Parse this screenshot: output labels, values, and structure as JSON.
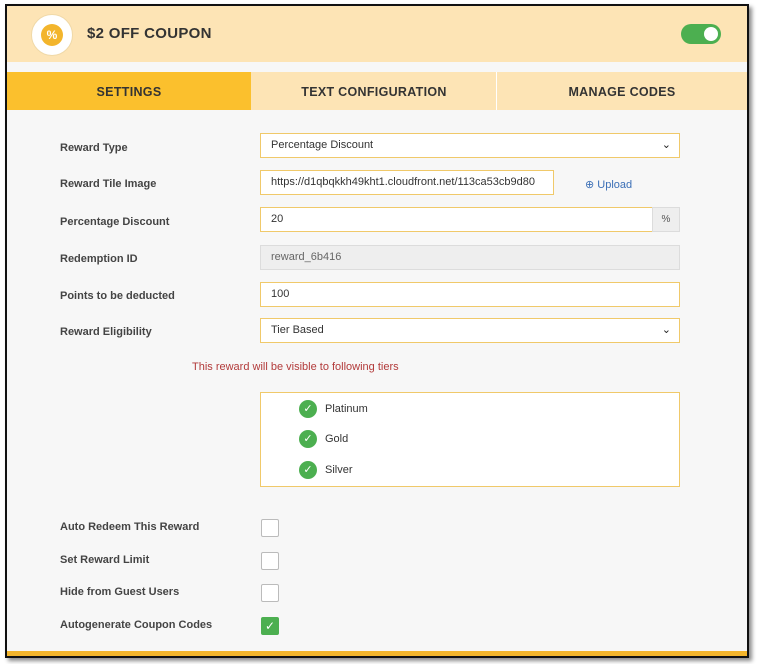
{
  "header": {
    "icon": "percent-badge-icon",
    "icon_glyph": "%",
    "title": "$2 OFF COUPON",
    "enabled": true
  },
  "tabs": [
    {
      "label": "SETTINGS",
      "active": true
    },
    {
      "label": "TEXT CONFIGURATION",
      "active": false
    },
    {
      "label": "MANAGE CODES",
      "active": false
    }
  ],
  "form": {
    "reward_type": {
      "label": "Reward Type",
      "value": "Percentage Discount"
    },
    "tile_image": {
      "label": "Reward Tile Image",
      "value": "https://d1qbqkkh49kht1.cloudfront.net/113ca53cb9d80",
      "upload_label": "Upload"
    },
    "percentage": {
      "label": "Percentage Discount",
      "value": "20",
      "suffix": "%"
    },
    "redemption_id": {
      "label": "Redemption ID",
      "value": "reward_6b416"
    },
    "points": {
      "label": "Points to be deducted",
      "value": "100"
    },
    "eligibility": {
      "label": "Reward Eligibility",
      "value": "Tier Based"
    },
    "tiers_notice": "This reward will be visible to following tiers",
    "tiers": [
      {
        "name": "Platinum",
        "checked": true
      },
      {
        "name": "Gold",
        "checked": true
      },
      {
        "name": "Silver",
        "checked": true
      }
    ],
    "options": [
      {
        "label": "Auto Redeem This Reward",
        "checked": false
      },
      {
        "label": "Set Reward Limit",
        "checked": false
      },
      {
        "label": "Hide from Guest Users",
        "checked": false
      },
      {
        "label": "Autogenerate Coupon Codes",
        "checked": true
      }
    ]
  },
  "colors": {
    "accent": "#fbc02d",
    "header_bg": "#fde4b5",
    "success": "#4caf50",
    "notice": "#b23a3a",
    "link": "#3b6fb6"
  }
}
